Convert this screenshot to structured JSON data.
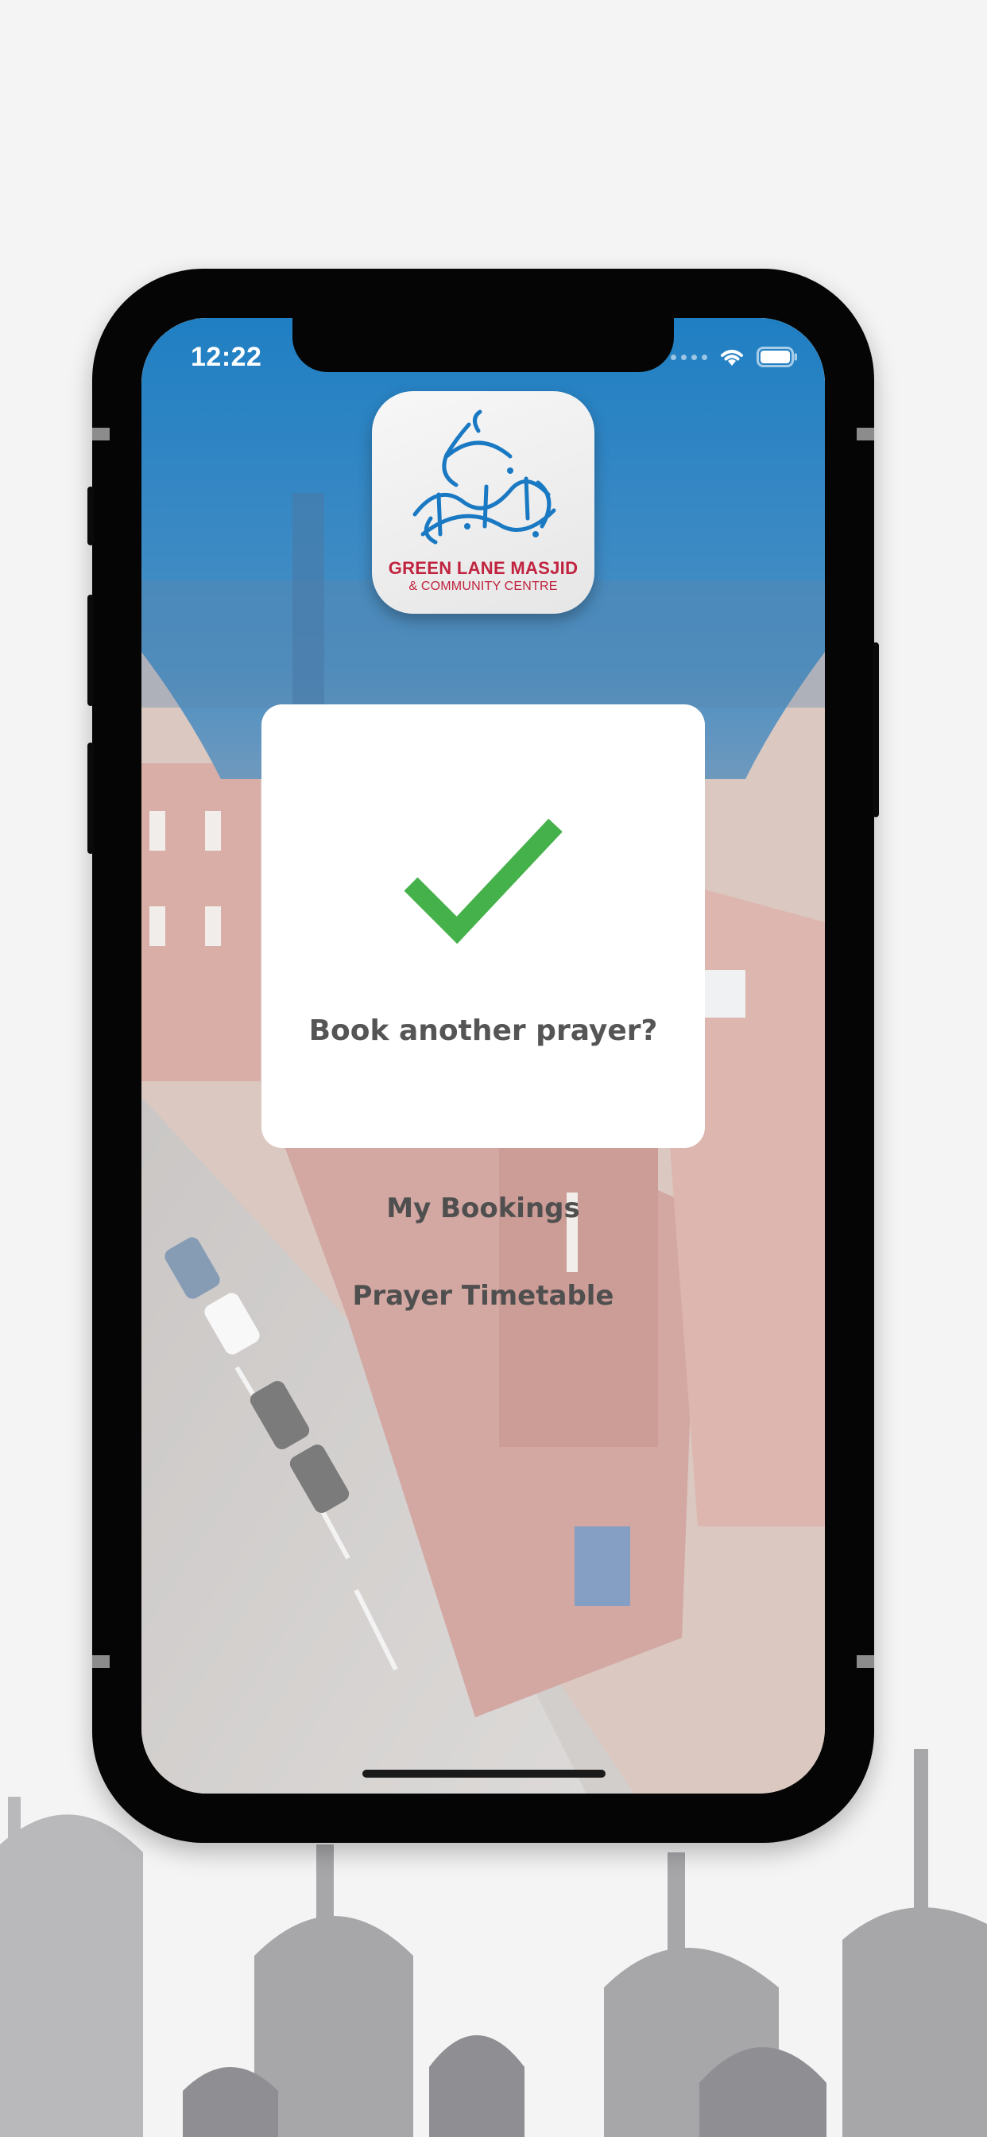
{
  "status_bar": {
    "time": "12:22"
  },
  "logo": {
    "title": "GREEN LANE MASJID",
    "subtitle": "& COMMUNITY CENTRE"
  },
  "confirmation": {
    "icon": "checkmark-icon",
    "prompt": "Book another prayer?"
  },
  "menu": {
    "items": [
      {
        "label": "My Bookings"
      },
      {
        "label": "Prayer Timetable"
      }
    ]
  },
  "colors": {
    "header_blue": "#1f7fc3",
    "check_green": "#44b14a",
    "logo_red": "#c0233f",
    "logo_blue": "#1a79c3",
    "text_grey": "#555555"
  }
}
